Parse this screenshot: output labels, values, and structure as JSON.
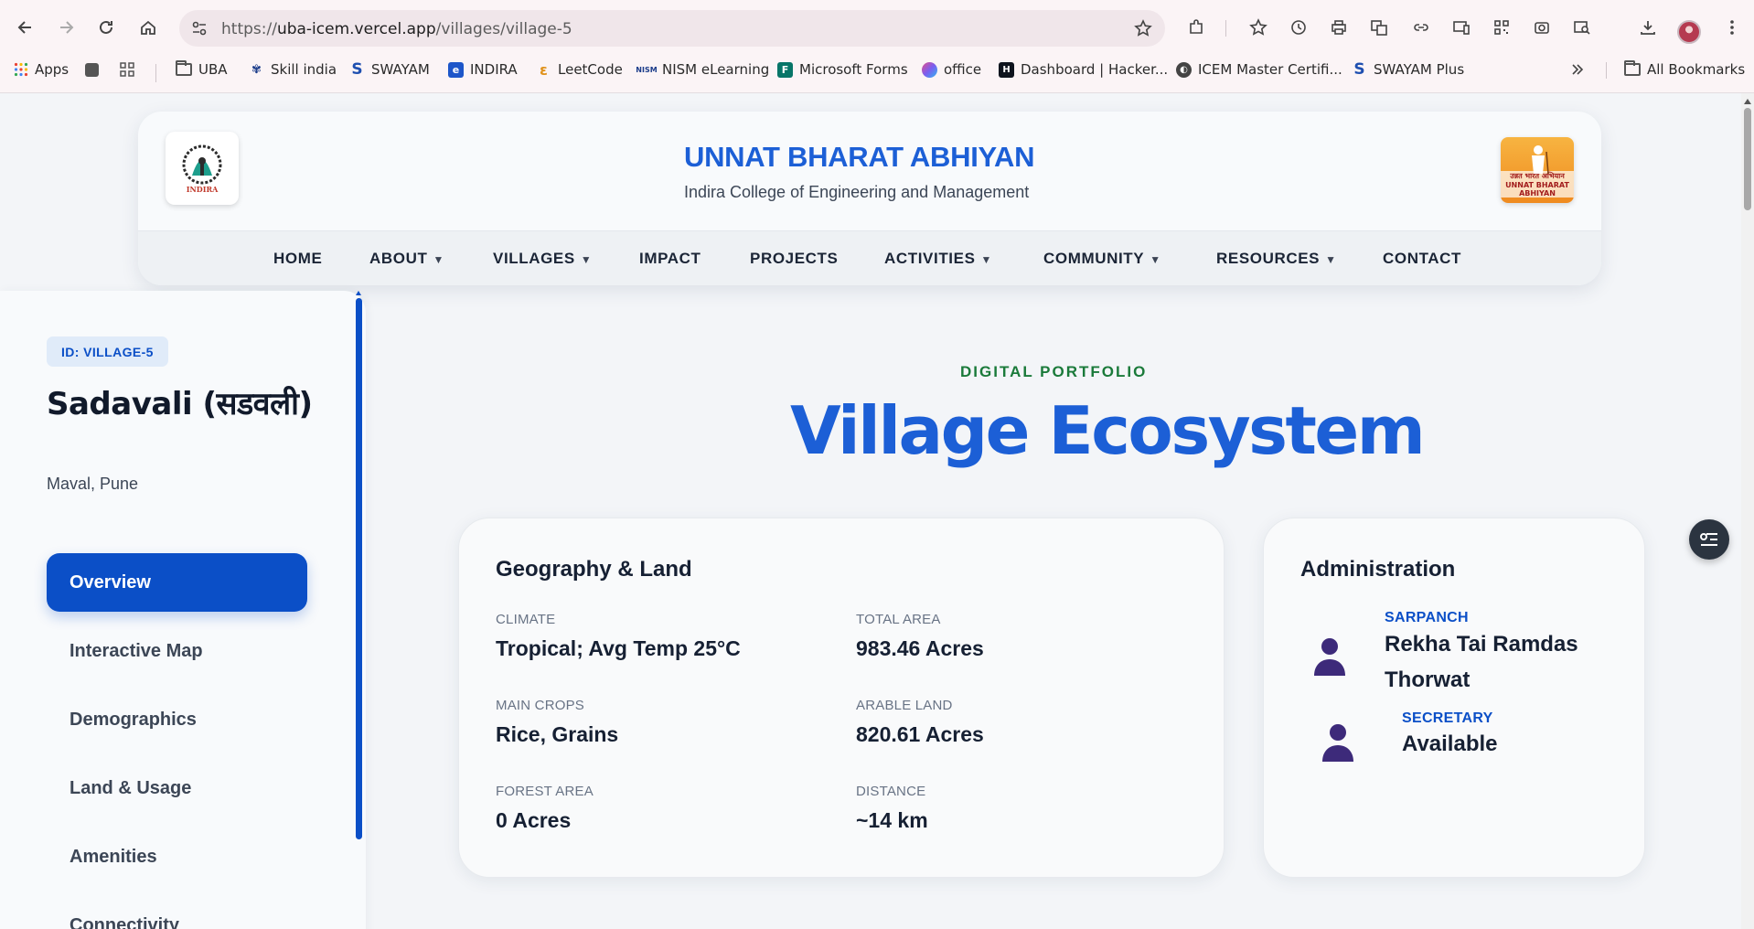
{
  "browser": {
    "url_prefix": "https://",
    "url_host": "uba-icem.vercel.app",
    "url_path": "/villages/village-5",
    "bookmarks": [
      {
        "label": "Apps",
        "icon": "apps-grid-icon"
      },
      {
        "label": "UBA",
        "icon": "folder-icon"
      },
      {
        "label": "Skill india",
        "icon": "skill-india-icon"
      },
      {
        "label": "SWAYAM",
        "icon": "swayam-icon"
      },
      {
        "label": "INDIRA",
        "icon": "indira-icon"
      },
      {
        "label": "LeetCode",
        "icon": "leetcode-icon"
      },
      {
        "label": "NISM eLearning",
        "icon": "nism-icon"
      },
      {
        "label": "Microsoft Forms",
        "icon": "forms-icon"
      },
      {
        "label": "office",
        "icon": "office-icon"
      },
      {
        "label": "Dashboard | Hacker...",
        "icon": "hackerrank-icon"
      },
      {
        "label": "ICEM Master Certifi...",
        "icon": "globe-icon"
      },
      {
        "label": "SWAYAM Plus",
        "icon": "swayam-icon"
      }
    ],
    "all_bookmarks_label": "All Bookmarks"
  },
  "header": {
    "title": "UNNAT BHARAT ABHIYAN",
    "subtitle": "Indira College of Engineering and Management",
    "logo_left_text": "INDIRA",
    "logo_right_text": "उन्नत भारत अभियान UNNAT BHARAT ABHIYAN",
    "menu": [
      {
        "label": "HOME",
        "dropdown": false
      },
      {
        "label": "ABOUT",
        "dropdown": true
      },
      {
        "label": "VILLAGES",
        "dropdown": true
      },
      {
        "label": "IMPACT",
        "dropdown": false
      },
      {
        "label": "PROJECTS",
        "dropdown": false
      },
      {
        "label": "ACTIVITIES",
        "dropdown": true
      },
      {
        "label": "COMMUNITY",
        "dropdown": true
      },
      {
        "label": "RESOURCES",
        "dropdown": true
      },
      {
        "label": "CONTACT",
        "dropdown": false
      }
    ],
    "caret": "▼"
  },
  "sidebar": {
    "badge": "ID: VILLAGE-5",
    "village_name": "Sadavali (सडवली)",
    "location": "Maval, Pune",
    "nav": [
      "Overview",
      "Interactive Map",
      "Demographics",
      "Land & Usage",
      "Amenities",
      "Connectivity"
    ],
    "active_index": 0
  },
  "main": {
    "kicker": "DIGITAL PORTFOLIO",
    "title": "Village Ecosystem",
    "geography": {
      "title": "Geography & Land",
      "fields": [
        {
          "label": "CLIMATE",
          "value": "Tropical; Avg Temp 25°C"
        },
        {
          "label": "TOTAL AREA",
          "value": "983.46 Acres"
        },
        {
          "label": "MAIN CROPS",
          "value": "Rice, Grains"
        },
        {
          "label": "ARABLE LAND",
          "value": "820.61 Acres"
        },
        {
          "label": "FOREST AREA",
          "value": "0 Acres"
        },
        {
          "label": "DISTANCE",
          "value": "~14 km"
        }
      ]
    },
    "administration": {
      "title": "Administration",
      "people": [
        {
          "role": "SARPANCH",
          "name": "Rekha Tai Ramdas Thorwat",
          "icon": "person-icon"
        },
        {
          "role": "SECRETARY",
          "name": "Available",
          "icon": "person-icon"
        }
      ]
    }
  },
  "colors": {
    "brand_blue": "#1c5fd6",
    "active_blue": "#0b4fc7",
    "kicker_green": "#1a7a3a",
    "person_purple": "#3d2a7a"
  }
}
